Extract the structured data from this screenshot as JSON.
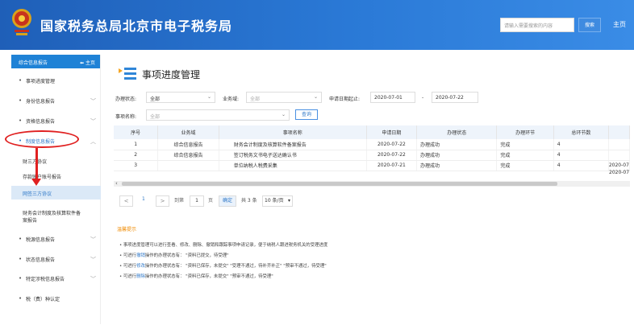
{
  "header": {
    "site_title": "国家税务总局北京市电子税务局",
    "search_placeholder": "请输入需要搜索的内容",
    "search_button": "搜索",
    "home_link": "主页"
  },
  "sidebar": {
    "section_title": "综合信息报告",
    "home_label": "主页",
    "items": [
      {
        "label": "事项进度管理",
        "has_chevron": false
      },
      {
        "label": "身份信息报告",
        "has_chevron": true
      },
      {
        "label": "资格信息报告",
        "has_chevron": true
      },
      {
        "label": "制度信息报告",
        "has_chevron": true
      },
      {
        "label": "税源信息报告",
        "has_chevron": true
      },
      {
        "label": "状态信息报告",
        "has_chevron": true
      },
      {
        "label": "特定涉税信息报告",
        "has_chevron": true
      },
      {
        "label": "税（费）种认定",
        "has_chevron": false
      }
    ],
    "sub_items": [
      {
        "label": "财三方协议"
      },
      {
        "label": "存款账户账号报告"
      },
      {
        "label": "网签三方协议"
      },
      {
        "label": "财务会计制度及核算软件备"
      },
      {
        "label": "案报告"
      }
    ]
  },
  "page": {
    "title": "事项进度管理"
  },
  "filters": {
    "status_label": "办理状态:",
    "status_value": "全部",
    "business_label": "业务域:",
    "business_value": "全部",
    "date_label": "申请日期起止:",
    "date_from": "2020-07-01",
    "date_sep": "-",
    "date_to": "2020-07-22",
    "item_label": "事项名称:",
    "item_value": "全部",
    "query_button": "查询"
  },
  "table": {
    "headers": [
      "序号",
      "业务域",
      "事项名称",
      "申请日期",
      "办理状态",
      "办理环节",
      "总环节数",
      ""
    ],
    "rows": [
      [
        "1",
        "综合信息报告",
        "财务会计制度及核算软件备案报告",
        "2020-07-22",
        "办理成功",
        "完成",
        "4",
        ""
      ],
      [
        "2",
        "综合信息报告",
        "签订税务文书电子送达确认书",
        "2020-07-22",
        "办理成功",
        "完成",
        "4",
        ""
      ],
      [
        "3",
        "",
        "单位纳税人税费采集",
        "2020-07-21",
        "办理成功",
        "完成",
        "4",
        "2020-07"
      ]
    ]
  },
  "pager": {
    "prev": "<",
    "page_num": "1",
    "next": ">",
    "goto_label": "到第",
    "goto_value": "1",
    "page_unit": "页",
    "confirm": "确定",
    "total": "共 3 条",
    "per_page": "10 条/页"
  },
  "tips": {
    "title": "温馨提示",
    "lines": [
      {
        "pre": "• 事项进度管理可以进行查看、修改、删除、撤销和跟踪事项申请记录，便于纳税人跟进税务机关的受理进度",
        "hl": "",
        "post": ""
      },
      {
        "pre": "• 可进行",
        "hl": "撤销",
        "post": "操作的办理状态有：  \"资料已提交，待受理\""
      },
      {
        "pre": "• 可进行",
        "hl": "修改",
        "post": "操作的办理状态有：  \"资料已保存，未提交\"    \"受理不通过，待补齐补正\"    \"预审不通过，待受理\""
      },
      {
        "pre": "• 可进行",
        "hl": "删除",
        "post": "操作的办理状态有：  \"资料已保存，未提交\"    \"预审不通过，待受理\""
      }
    ]
  },
  "colors": {
    "header_blue": "#2a79d6",
    "sidebar_head": "#1f82d6",
    "annotation_red": "#e02020",
    "tips_orange": "#f08a00"
  }
}
